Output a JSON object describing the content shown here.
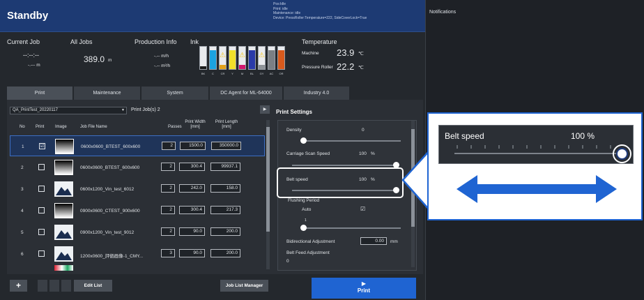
{
  "header": {
    "title": "Standby",
    "status_lines": [
      "Pos:Idle",
      "Print: idle",
      "Maintenance: idle",
      "Device: PressRoller:Temperature=222, SideCoverLock=True"
    ]
  },
  "notifications": {
    "label": "Notifications"
  },
  "info": {
    "current_job": {
      "label": "Current Job",
      "time": "--:--:--",
      "length": "-.--- m"
    },
    "all_jobs": {
      "label": "All Jobs",
      "value": "389.0",
      "unit": "m"
    },
    "production": {
      "label": "Production Info",
      "rate1": "-.-- m/h",
      "rate2": "-.-- m²/h"
    },
    "ink": {
      "label": "Ink",
      "colors": [
        "BK",
        "C",
        "CR",
        "Y",
        "M",
        "BL",
        "GY",
        "AC",
        "OR"
      ],
      "levels": [
        0.12,
        0.85,
        0.2,
        0.85,
        0.2,
        0.85,
        0.2,
        0.85,
        0.85
      ],
      "swatches": [
        "#1b1b1b",
        "#1ba3e0",
        "#e2a21a",
        "#f1e02a",
        "#d1166f",
        "#2a3aa8",
        "#8e9398",
        "#7b7f84",
        "#d95a1c"
      ],
      "warnings": [
        false,
        false,
        true,
        false,
        true,
        false,
        true,
        false,
        false
      ]
    },
    "temperature": {
      "label": "Temperature",
      "machine_label": "Machine",
      "machine_value": "23.9",
      "machine_unit": "℃",
      "roller_label": "Pressure Roller",
      "roller_value": "22.2",
      "roller_unit": "℃"
    }
  },
  "tabs": [
    {
      "label": "Print"
    },
    {
      "label": "Maintenance"
    },
    {
      "label": "System"
    },
    {
      "label": "DC Agent for ML-64000"
    },
    {
      "label": "Industry 4.0"
    }
  ],
  "job_list": {
    "selected_list": "QA_PrintTest_20220117",
    "job_count_label": "Print Job(s)",
    "job_count": "2",
    "columns": {
      "no": "No",
      "print": "Print",
      "image": "Image",
      "name": "Job File Name",
      "passes": "Passes",
      "width": "Print Width [mm]",
      "length": "Print Length [mm]"
    },
    "rows": [
      {
        "no": "1",
        "checked": "☑",
        "name": "0600x0600_BTEST_600x600",
        "passes": "2",
        "width": "1500.0",
        "length": "350000.0",
        "thumb": "grad"
      },
      {
        "no": "2",
        "checked": "",
        "name": "0600x0600_BTEST_600x600",
        "passes": "2",
        "width": "300.4",
        "length": "99937.1",
        "thumb": "grad"
      },
      {
        "no": "3",
        "checked": "",
        "name": "0600x1200_Vin_test_6012",
        "passes": "2",
        "width": "242.0",
        "length": "158.0",
        "thumb": "pic"
      },
      {
        "no": "4",
        "checked": "",
        "name": "0900x0600_CTEST_900x600",
        "passes": "2",
        "width": "300.4",
        "length": "217.3",
        "thumb": "grad"
      },
      {
        "no": "5",
        "checked": "",
        "name": "0900x1200_Vin_test_9012",
        "passes": "2",
        "width": "90.0",
        "length": "200.0",
        "thumb": "pic"
      },
      {
        "no": "6",
        "checked": "",
        "name": "1200x0600_評価画像-1_CMY...",
        "passes": "3",
        "width": "90.0",
        "length": "200.0",
        "thumb": "pic"
      }
    ]
  },
  "print_settings": {
    "title": "Print Settings",
    "density_label": "Density",
    "density_value": "0",
    "carriage_label": "Carriage Scan Speed",
    "carriage_value": "100",
    "carriage_unit": "%",
    "belt_label": "Belt speed",
    "belt_value": "100",
    "belt_unit": "%",
    "flushing_label": "Flushing Period",
    "flushing_auto": "Auto",
    "flushing_one": "1",
    "bidir_label": "Bidirectional Adjustment",
    "bidir_value": "0.00",
    "bidir_unit": "mm",
    "beltfeed_label": "Belt Feed Adjustment",
    "beltfeed_value": "0"
  },
  "footer": {
    "add": "+",
    "edit_list": "Edit List",
    "job_list_manager": "Job List Manager",
    "print_icon": "▶",
    "print": "Print"
  },
  "zoom": {
    "label": "Belt speed",
    "value": "100",
    "unit": "%"
  }
}
